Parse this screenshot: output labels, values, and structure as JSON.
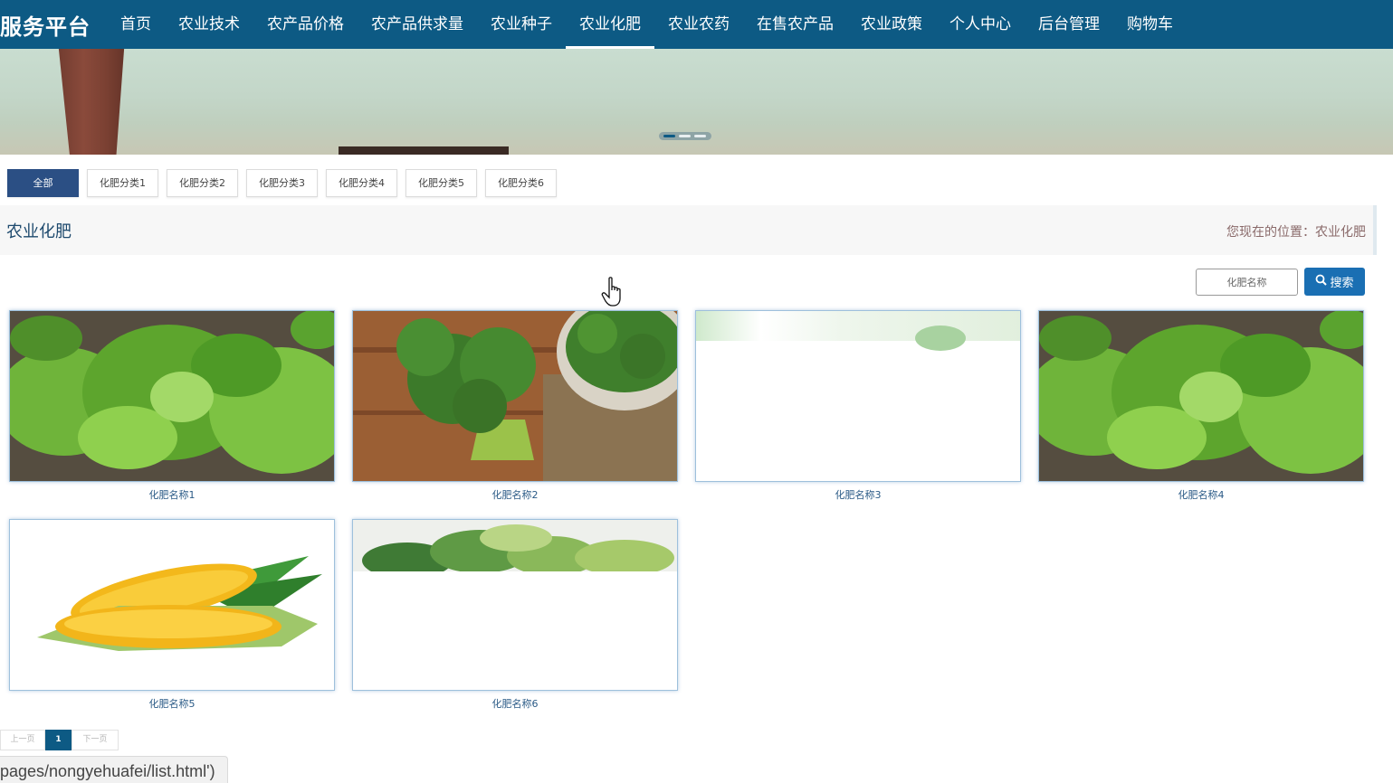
{
  "brand": "服务平台",
  "nav": {
    "items": [
      "首页",
      "农业技术",
      "农产品价格",
      "农产品供求量",
      "农业种子",
      "农业化肥",
      "农业农药",
      "在售农产品",
      "农业政策",
      "个人中心",
      "后台管理",
      "购物车"
    ],
    "active": "农业化肥"
  },
  "categories": {
    "all": "全部",
    "items": [
      "化肥分类1",
      "化肥分类2",
      "化肥分类3",
      "化肥分类4",
      "化肥分类5",
      "化肥分类6"
    ]
  },
  "section": {
    "title": "农业化肥",
    "breadcrumb": "您现在的位置：农业化肥"
  },
  "search": {
    "placeholder": "化肥名称",
    "button_label": "搜索"
  },
  "products": [
    {
      "name": "化肥名称1",
      "image": "lettuce"
    },
    {
      "name": "化肥名称2",
      "image": "broccoli"
    },
    {
      "name": "化肥名称3",
      "image": "greens-faded"
    },
    {
      "name": "化肥名称4",
      "image": "lettuce"
    },
    {
      "name": "化肥名称5",
      "image": "corn"
    },
    {
      "name": "化肥名称6",
      "image": "lettuce-faded"
    }
  ],
  "pagination": {
    "prev": "上一页",
    "current": "1",
    "next": "下一页"
  },
  "status_url": "pages/nongyehuafei/list.html')",
  "colors": {
    "nav_bg": "#0d5a84",
    "category_active": "#2b4f84",
    "search_button": "#1a6fb3",
    "link": "#2a5a86"
  }
}
